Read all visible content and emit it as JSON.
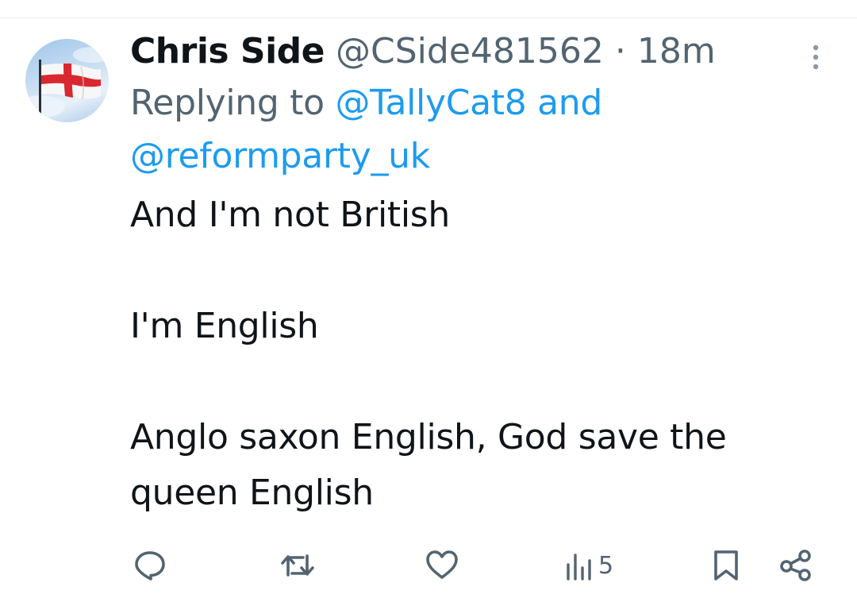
{
  "tweet": {
    "display_name": "Chris Side",
    "handle": "@CSide481562",
    "separator": "·",
    "time": "18m",
    "reply_prefix": "Replying to",
    "reply_mention_1": "@TallyCat8",
    "reply_joiner": "and",
    "reply_mention_2": "@reformparty_uk",
    "text_lines": [
      "And I'm not British",
      "I'm English",
      "Anglo saxon English, God save the",
      "queen English"
    ],
    "views": "5"
  },
  "icons": {
    "avatar": "england-flag-avatar",
    "more": "more-vertical-icon",
    "reply": "reply-icon",
    "retweet": "retweet-icon",
    "like": "heart-icon",
    "views": "analytics-icon",
    "bookmark": "bookmark-icon",
    "share": "share-icon"
  },
  "colors": {
    "text": "#0f1419",
    "secondary": "#536471",
    "mention": "#1d9bf0",
    "flag_red": "#d9282f"
  }
}
